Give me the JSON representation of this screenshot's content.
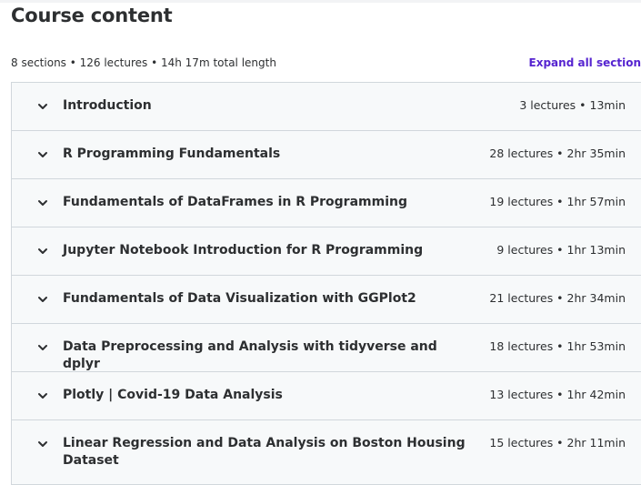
{
  "title": "Course content",
  "summary": "8 sections • 126 lectures • 14h 17m total length",
  "expand_all_label": "Expand all section",
  "sections": [
    {
      "title": "Introduction",
      "meta": "3 lectures • 13min"
    },
    {
      "title": "R Programming Fundamentals",
      "meta": "28 lectures • 2hr 35min"
    },
    {
      "title": "Fundamentals of DataFrames in R Programming",
      "meta": "19 lectures • 1hr 57min"
    },
    {
      "title": "Jupyter Notebook Introduction for R Programming",
      "meta": "9 lectures • 1hr 13min"
    },
    {
      "title": "Fundamentals of Data Visualization with GGPlot2",
      "meta": "21 lectures • 2hr 34min"
    },
    {
      "title": "Data Preprocessing and Analysis with tidyverse and dplyr",
      "meta": "18 lectures • 1hr 53min"
    },
    {
      "title": "Plotly | Covid-19 Data Analysis",
      "meta": "13 lectures • 1hr 42min"
    },
    {
      "title": "Linear Regression and Data Analysis on Boston Housing Dataset",
      "meta": "15 lectures • 2hr 11min"
    }
  ],
  "icons": {
    "section_toggle": "chevron-down-icon"
  },
  "colors": {
    "accent": "#5624d0",
    "section_bg": "#f7f9fa",
    "border": "#d1d7dc",
    "text": "#2d2f31"
  }
}
